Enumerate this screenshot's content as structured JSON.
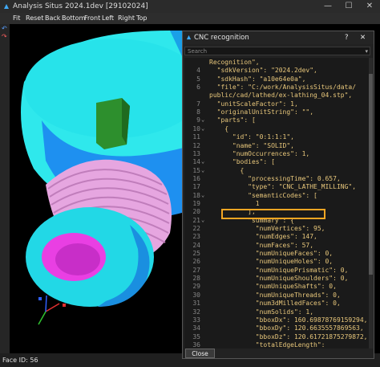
{
  "window": {
    "title": "Analysis Situs 2024.1dev [29102024]",
    "min": "—",
    "max": "☐",
    "close": "✕"
  },
  "toolbar": [
    "Fit",
    "Reset",
    "Back",
    "Bottom",
    "Front",
    "Left",
    "Right",
    "Top"
  ],
  "status": "Face ID: 56",
  "dialog": {
    "title": "CNC recognition",
    "help": "?",
    "close": "✕",
    "search_placeholder": "Search",
    "close_button": "Close",
    "lines": [
      {
        "n": "",
        "f": "",
        "t": "Recognition\","
      },
      {
        "n": "4",
        "f": "",
        "t": "  \"sdkVersion\": \"2024.2dev\","
      },
      {
        "n": "5",
        "f": "",
        "t": "  \"sdkHash\": \"a10e64e0a\","
      },
      {
        "n": "6",
        "f": "",
        "t": "  \"file\": \"C:/work/AnalysisSitus/data/"
      },
      {
        "n": "",
        "f": "",
        "t": "public/cad/lathed/ex-lathing_04.stp\","
      },
      {
        "n": "7",
        "f": "",
        "t": "  \"unitScaleFactor\": 1,"
      },
      {
        "n": "8",
        "f": "",
        "t": "  \"originalUnitString\": \"\","
      },
      {
        "n": "9",
        "f": "v",
        "t": "  \"parts\": ["
      },
      {
        "n": "10",
        "f": "v",
        "t": "    {"
      },
      {
        "n": "11",
        "f": "",
        "t": "      \"id\": \"0:1:1:1\","
      },
      {
        "n": "12",
        "f": "",
        "t": "      \"name\": \"SOLID\","
      },
      {
        "n": "13",
        "f": "",
        "t": "      \"numOccurrences\": 1,"
      },
      {
        "n": "14",
        "f": "v",
        "t": "      \"bodies\": ["
      },
      {
        "n": "15",
        "f": "v",
        "t": "        {"
      },
      {
        "n": "16",
        "f": "",
        "t": "          \"processingTime\": 0.657,"
      },
      {
        "n": "17",
        "f": "",
        "t": "          \"type\": \"CNC_LATHE_MILLING\","
      },
      {
        "n": "18",
        "f": "v",
        "t": "          \"semanticCodes\": ["
      },
      {
        "n": "19",
        "f": "",
        "t": "            1"
      },
      {
        "n": "20",
        "f": "",
        "t": "          ],"
      },
      {
        "n": "21",
        "f": "v",
        "t": "          \"summary\": {"
      },
      {
        "n": "22",
        "f": "",
        "t": "            \"numVertices\": 95,"
      },
      {
        "n": "23",
        "f": "",
        "t": "            \"numEdges\": 147,"
      },
      {
        "n": "24",
        "f": "",
        "t": "            \"numFaces\": 57,"
      },
      {
        "n": "25",
        "f": "",
        "t": "            \"numUniqueFaces\": 0,"
      },
      {
        "n": "26",
        "f": "",
        "t": "            \"numUniqueHoles\": 0,"
      },
      {
        "n": "27",
        "f": "",
        "t": "            \"numUniquePrismatic\": 0,"
      },
      {
        "n": "28",
        "f": "",
        "t": "            \"numUniqueShoulders\": 0,"
      },
      {
        "n": "29",
        "f": "",
        "t": "            \"numUniqueShafts\": 0,"
      },
      {
        "n": "30",
        "f": "",
        "t": "            \"numUniqueThreads\": 0,"
      },
      {
        "n": "31",
        "f": "",
        "t": "            \"num3dMilledFaces\": 0,"
      },
      {
        "n": "32",
        "f": "",
        "t": "            \"numSolids\": 1,"
      },
      {
        "n": "33",
        "f": "",
        "t": "            \"bboxDx\": 160.69878769159294,"
      },
      {
        "n": "34",
        "f": "",
        "t": "            \"bboxDy\": 120.6635557869563,"
      },
      {
        "n": "35",
        "f": "",
        "t": "            \"bboxDz\": 120.61721875279872,"
      },
      {
        "n": "36",
        "f": "",
        "t": "            \"totalEdgeLength\":"
      }
    ]
  }
}
